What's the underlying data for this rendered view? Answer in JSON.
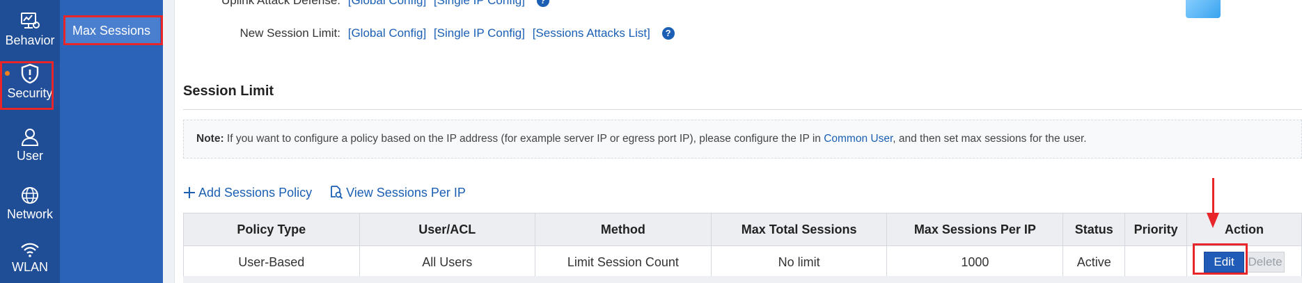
{
  "rail": {
    "items": [
      {
        "label": "Behavior",
        "icon": "behavior-monitor-icon"
      },
      {
        "label": "Security",
        "icon": "shield-alert-icon",
        "active": true
      },
      {
        "label": "User",
        "icon": "user-icon"
      },
      {
        "label": "Network",
        "icon": "network-globe-icon"
      },
      {
        "label": "WLAN",
        "icon": "wifi-icon"
      }
    ]
  },
  "submenu": {
    "selected": "Max Sessions"
  },
  "config_rows": [
    {
      "label": "Uplink Attack Defense:",
      "links": [
        "[Global Config]",
        "[Single IP Config]"
      ]
    },
    {
      "label": "New Session Limit:",
      "links": [
        "[Global Config]",
        "[Single IP Config]",
        "[Sessions Attacks List]"
      ]
    }
  ],
  "help_glyph": "?",
  "section": {
    "title": "Session Limit"
  },
  "note": {
    "prefix": "Note:",
    "text_before": " If you want to configure a policy based on the IP address (for example server IP or egress port IP), please configure the IP in ",
    "link": "Common User",
    "text_after": ", and then set max sessions for the user."
  },
  "actions": {
    "add": "Add Sessions Policy",
    "view": "View Sessions Per IP"
  },
  "table": {
    "headers": [
      "Policy Type",
      "User/ACL",
      "Method",
      "Max Total Sessions",
      "Max Sessions Per IP",
      "Status",
      "Priority",
      "Action"
    ],
    "rows": [
      {
        "policy_type": "User-Based",
        "user_acl": "All Users",
        "method": "Limit Session Count",
        "max_total": "No limit",
        "max_per_ip": "1000",
        "status": "Active",
        "priority": "",
        "edit": "Edit",
        "delete": "Delete"
      }
    ]
  },
  "colors": {
    "rail": "#1f4e97",
    "submenu": "#2b63b8",
    "highlight": "#e8262a",
    "link": "#1a5fb4",
    "priority": "#e33b1a"
  }
}
